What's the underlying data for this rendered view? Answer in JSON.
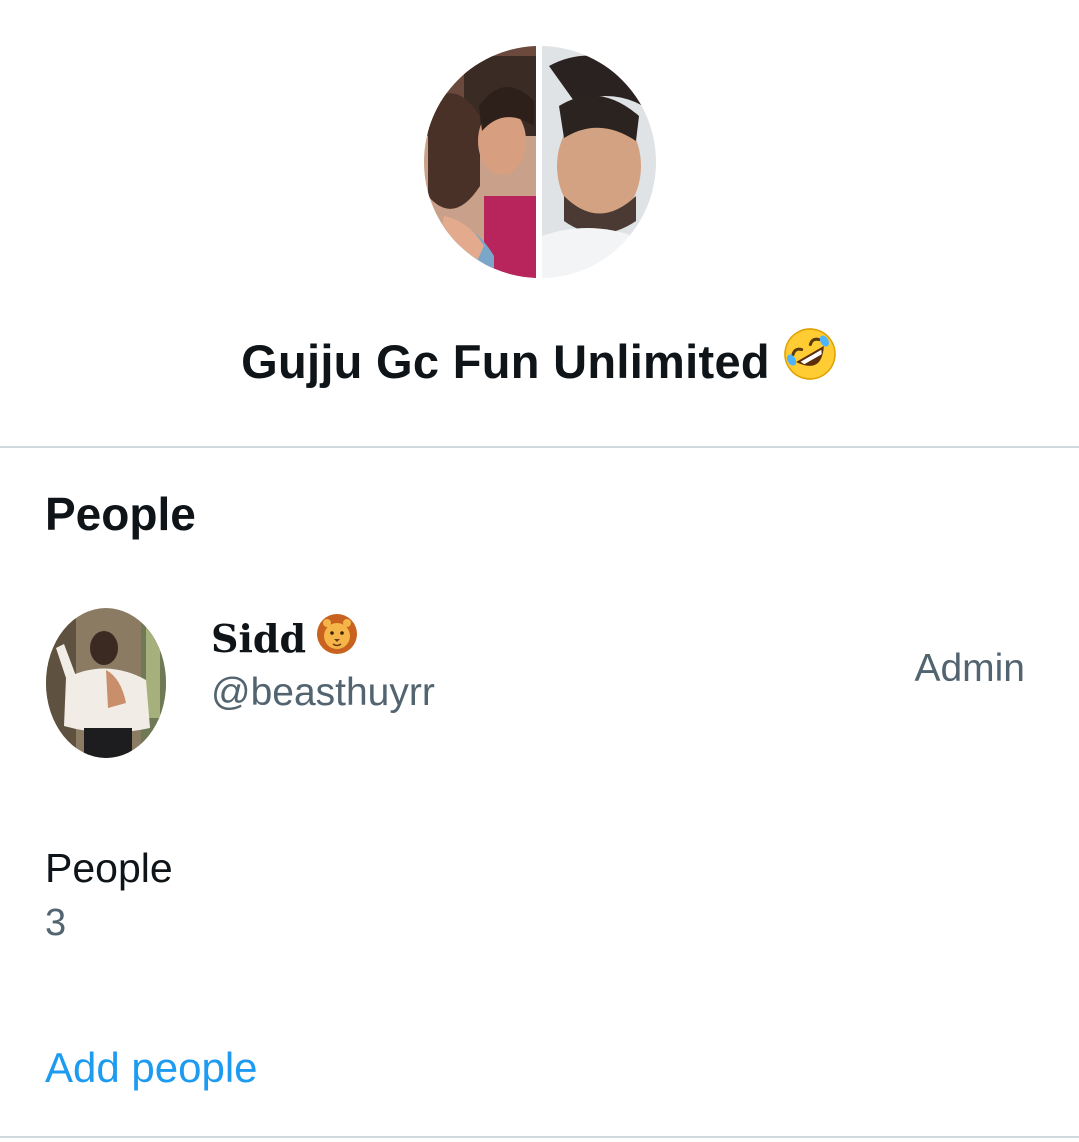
{
  "group": {
    "name": "Gujju Gc Fun Unlimited",
    "name_emoji": "rolling-on-floor-laughing-emoji"
  },
  "people_section": {
    "title": "People",
    "members": [
      {
        "display_name": "Sidd",
        "name_emoji": "lion-face-emoji",
        "handle": "@beasthuyrr",
        "role": "Admin"
      }
    ]
  },
  "people_count": {
    "label": "People",
    "value": "3"
  },
  "actions": {
    "add_people_label": "Add people"
  },
  "colors": {
    "text_primary": "#0f1419",
    "text_secondary": "#536471",
    "link": "#1d9bf0",
    "divider": "#cfd9de"
  }
}
